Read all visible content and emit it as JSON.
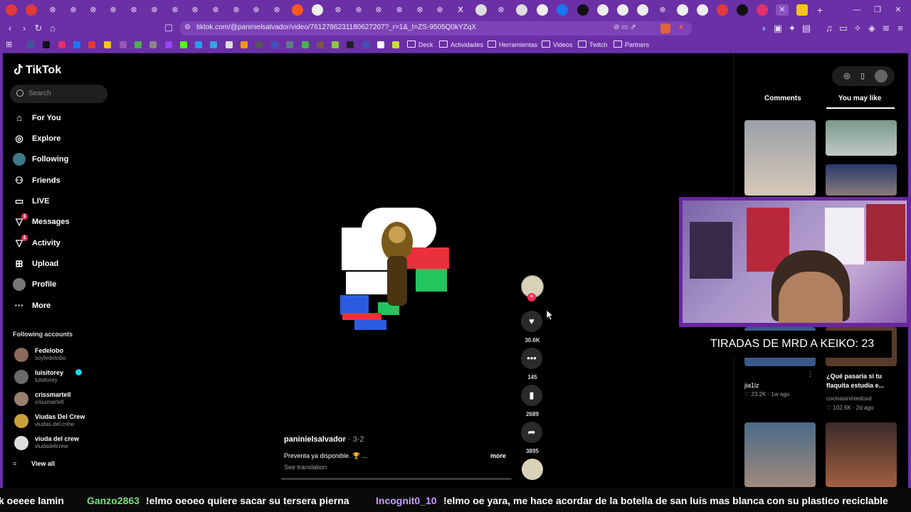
{
  "browser": {
    "url": "tiktok.com/@paninielsalvador/video/7612786231180627207?_r=1&_t=ZS-9505Q0kYZqX",
    "bookmark_folders": [
      "Deck",
      "Actividades",
      "Herramientas",
      "Videos",
      "Twitch",
      "Partners"
    ]
  },
  "tiktok": {
    "logo": "TikTok",
    "search_placeholder": "Search",
    "nav": [
      {
        "label": "For You",
        "icon": "home-icon"
      },
      {
        "label": "Explore",
        "icon": "compass-icon"
      },
      {
        "label": "Following",
        "icon": "following-avatar-icon"
      },
      {
        "label": "Friends",
        "icon": "friends-icon"
      },
      {
        "label": "LIVE",
        "icon": "live-icon"
      },
      {
        "label": "Messages",
        "icon": "messages-icon",
        "badge": "1"
      },
      {
        "label": "Activity",
        "icon": "activity-icon",
        "badge": "1"
      },
      {
        "label": "Upload",
        "icon": "upload-icon"
      },
      {
        "label": "Profile",
        "icon": "profile-avatar-icon"
      },
      {
        "label": "More",
        "icon": "more-icon"
      }
    ],
    "following_title": "Following accounts",
    "accounts": [
      {
        "name": "Fedelobo",
        "handle": "soyfedelobo"
      },
      {
        "name": "luisitorey",
        "handle": "luisitorey"
      },
      {
        "name": "crissmartell",
        "handle": "crissmartell"
      },
      {
        "name": "Viudas Del Crew",
        "handle": "viudas.del.crew"
      },
      {
        "name": "viuda del crew",
        "handle": "viudadelcrew"
      }
    ],
    "view_all": "View all",
    "video": {
      "author": "paninielsalvador",
      "date": "· 3-2",
      "description": "Preventa ya disponible. 🏆 ...",
      "more": "more",
      "see_translation": "See translation",
      "likes": "30.6K",
      "comments": "145",
      "saves": "2689",
      "shares": "3895"
    },
    "right_tabs": {
      "comments": "Comments",
      "you_may_like": "You may like"
    },
    "suggestions": [
      {
        "author": "jia1lz",
        "likes": "23.2K",
        "ago": "1w ago"
      },
      {
        "title": "¿Qué pasaría si tu flaquita estudia e...",
        "author": "cocinasinmiedoxd",
        "likes": "102.6K",
        "ago": "2d ago"
      }
    ]
  },
  "overlay": {
    "counter": "TIRADAS DE MRD A KEIKO: 23"
  },
  "chat": [
    {
      "user": "",
      "msg": "k oeeee lamin"
    },
    {
      "user": "Ganzo2863",
      "msg": "!elmo oeoeo quiere sacar su tersera pierna"
    },
    {
      "user": "Incognit0_10",
      "msg": "!elmo oe yara, me hace acordar de la botella de san luis mas blanca con su plastico reciclable"
    }
  ],
  "colors": {
    "accent": "#fe2c55",
    "browser": "#6b2fa6",
    "chat_user": "#7be07b",
    "chat_user2": "#c79bff"
  }
}
